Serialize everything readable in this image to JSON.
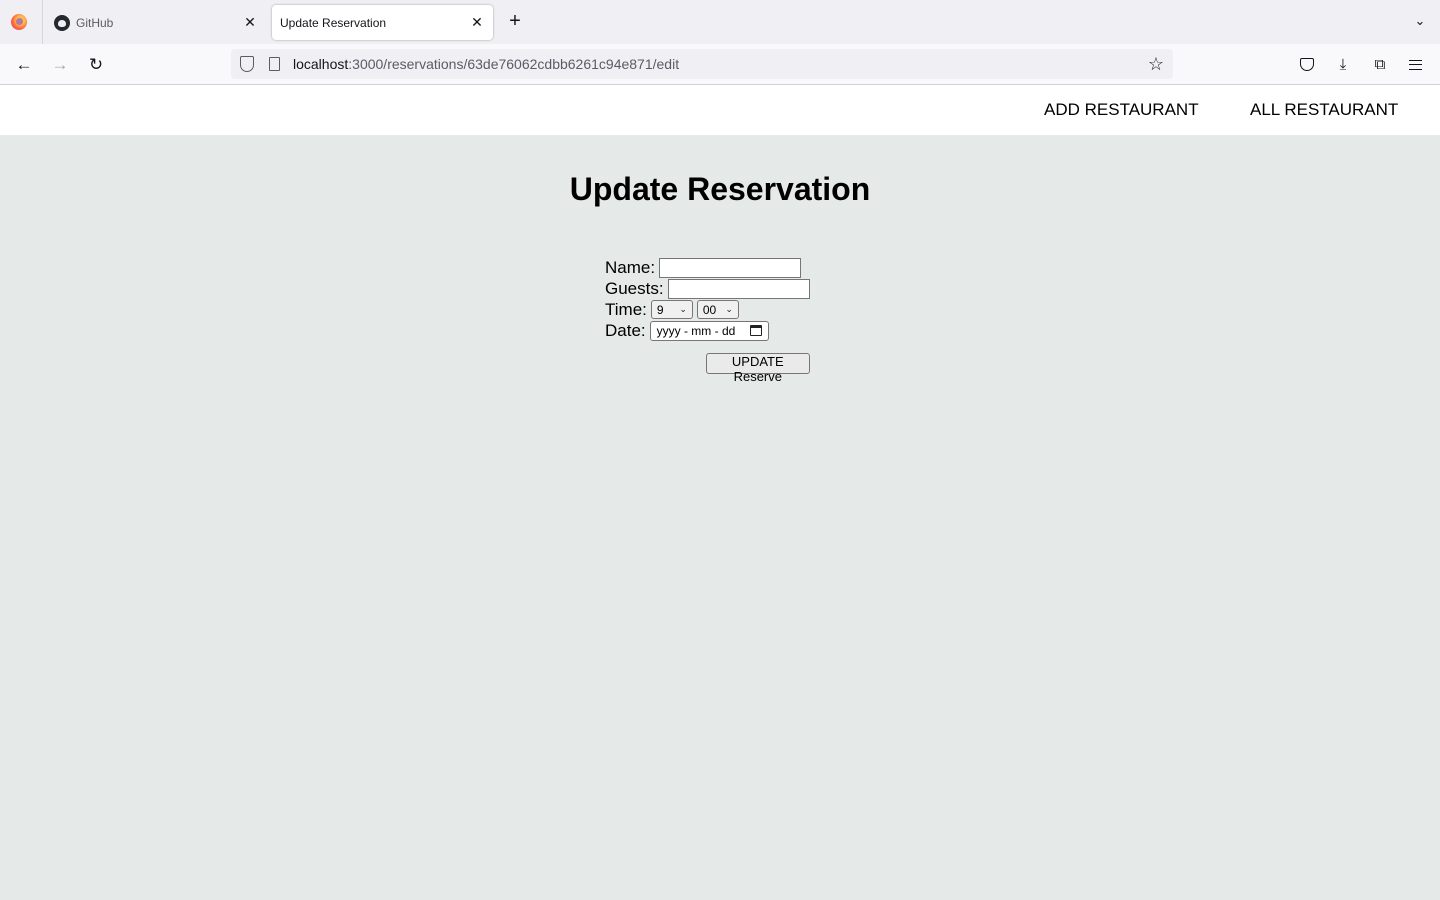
{
  "browser": {
    "tabs": [
      {
        "title": "GitHub",
        "close": "✕"
      },
      {
        "title": "Update Reservation",
        "close": "✕"
      }
    ],
    "new_tab": "+",
    "url_host": "localhost",
    "url_rest": ":3000/reservations/63de76062cdbb6261c94e871/edit"
  },
  "site": {
    "nav": [
      "ADD RESTAURANT",
      "ALL RESTAURANT"
    ]
  },
  "page": {
    "heading": "Update Reservation"
  },
  "form": {
    "name_label": "Name:",
    "name_value": "",
    "guests_label": "Guests:",
    "guests_value": "",
    "time_label": "Time:",
    "hour_value": "9",
    "minute_value": "00",
    "date_label": "Date:",
    "date_placeholder": "yyyy - mm - dd",
    "submit_label": "UPDATE Reserve"
  }
}
